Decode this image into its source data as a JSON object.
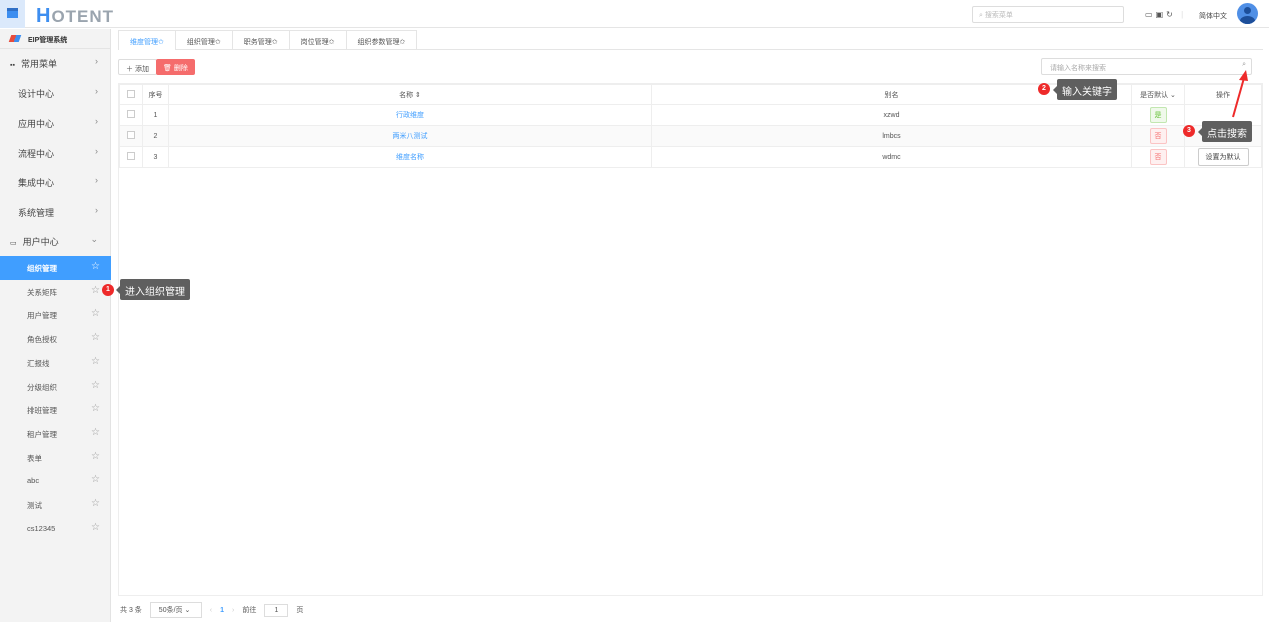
{
  "header": {
    "logo": "HOTENT",
    "search_placeholder": "搜索菜单",
    "language": "简体中文"
  },
  "sidebar": {
    "system": "EIP管理系统",
    "groups": [
      "常用菜单",
      "设计中心",
      "应用中心",
      "流程中心",
      "集成中心",
      "系统管理",
      "用户中心"
    ],
    "subitems": [
      "组织管理",
      "关系矩阵",
      "用户管理",
      "角色授权",
      "汇报线",
      "分级组织",
      "排班管理",
      "租户管理",
      "表单",
      "abc",
      "测试",
      "cs12345"
    ],
    "active": "组织管理"
  },
  "tabs": [
    "维度管理✩",
    "组织管理✩",
    "职务管理✩",
    "岗位管理✩",
    "组织参数管理✩"
  ],
  "toolbar": {
    "add": "添加",
    "delete": "删除",
    "search_placeholder": "请输入名称来搜索"
  },
  "table": {
    "headers": [
      "序号",
      "名称",
      "别名",
      "是否默认",
      "操作"
    ],
    "rows": [
      {
        "no": "1",
        "name": "行政维度",
        "alias": "xzwd",
        "default": "是",
        "action": ""
      },
      {
        "no": "2",
        "name": "两米八测试",
        "alias": "lmbcs",
        "default": "否",
        "action": ""
      },
      {
        "no": "3",
        "name": "维度名称",
        "alias": "wdmc",
        "default": "否",
        "action": "设置为默认"
      }
    ]
  },
  "pagination": {
    "total": "共 3 条",
    "page_size": "50条/页",
    "current": "1",
    "goto_label": "前往",
    "goto_value": "1",
    "page_suffix": "页"
  },
  "annotations": [
    {
      "n": "1",
      "text": "进入组织管理"
    },
    {
      "n": "2",
      "text": "输入关键字"
    },
    {
      "n": "3",
      "text": "点击搜索"
    }
  ]
}
